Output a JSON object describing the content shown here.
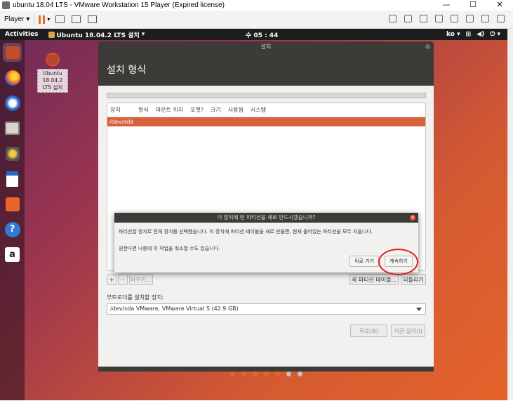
{
  "vmware": {
    "title": "ubuntu 18.04 LTS - VMware Workstation 15 Player (Expired license)",
    "player_label": "Player",
    "window_controls": [
      "—",
      "☐",
      "✕"
    ]
  },
  "topbar": {
    "activities": "Activities",
    "app_menu": "Ubuntu 18.04.2 LTS 설치",
    "clock": "수 05 : 44",
    "input_method": "ko"
  },
  "dock": {
    "items": [
      {
        "icon": "installer-icon"
      },
      {
        "icon": "firefox-icon"
      },
      {
        "icon": "thunderbird-icon"
      },
      {
        "icon": "files-icon"
      },
      {
        "icon": "rhythmbox-icon"
      },
      {
        "icon": "writer-icon"
      },
      {
        "icon": "software-icon"
      },
      {
        "icon": "help-icon",
        "glyph": "?"
      },
      {
        "icon": "amazon-icon",
        "glyph": "a"
      }
    ]
  },
  "desktop_icon": {
    "label": "Ubuntu 18.04.2 LTS 설치"
  },
  "installer": {
    "window_title": "설치",
    "heading": "설치 형식",
    "columns": [
      "장치",
      "형식",
      "마운트 위치",
      "포맷?",
      "크기",
      "사용됨",
      "시스템"
    ],
    "device_row": "/dev/sda",
    "add_btn": "+",
    "remove_btn": "−",
    "change_btn": "바꾸기...",
    "new_table_btn": "새 파티션 테이블...",
    "revert_btn": "되돌리기",
    "bootloader_label": "부트로더를 설치할 장치:",
    "bootloader_value": "/dev/sda VMware, VMware Virtual S (42.9 GB)",
    "back_btn": "뒤로(B)",
    "install_now_btn": "지금 설치(I)",
    "progress_total": 7,
    "progress_done": 5
  },
  "dialog": {
    "title": "이 장치에 빈 파티션을 새로 만드시겠습니까?",
    "message1": "파티션할 장치로 전체 장치를 선택했습니다. 이 장치에 파티션 테이블을 새로 만들면, 현재 들어있는 파티션을 모두 지웁니다.",
    "message2": "원한다면 나중에 이 작업을 취소할 수도 있습니다.",
    "back_btn": "뒤로 가기",
    "continue_btn": "계속하기"
  },
  "colors": {
    "ubuntu_orange": "#e0692f",
    "selection": "#d7613a",
    "annotation_ring": "#e01b1b"
  }
}
